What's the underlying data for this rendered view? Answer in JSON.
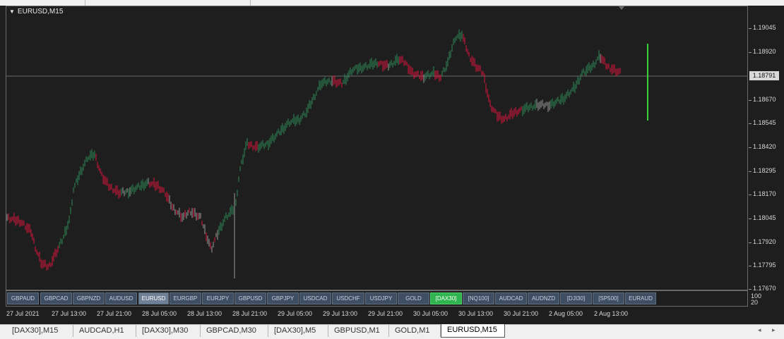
{
  "chart": {
    "symbol": "EURUSD,M15",
    "current_price": "1.18791",
    "price_ticks": [
      "1.19045",
      "1.18920",
      "1.18791",
      "1.18670",
      "1.18545",
      "1.18420",
      "1.18295",
      "1.18170",
      "1.18045",
      "1.17920",
      "1.17795",
      "1.17670"
    ],
    "indicator_ticks": [
      "100",
      "20"
    ],
    "time_labels": [
      "27 Jul 2021",
      "27 Jul 13:00",
      "27 Jul 21:00",
      "28 Jul 05:00",
      "28 Jul 13:00",
      "28 Jul 21:00",
      "29 Jul 05:00",
      "29 Jul 13:00",
      "29 Jul 21:00",
      "30 Jul 05:00",
      "30 Jul 13:00",
      "30 Jul 21:00",
      "2 Aug 05:00",
      "2 Aug 13:00"
    ],
    "colors": {
      "bull": "#2e8b57",
      "bear": "#dc143c",
      "neutral": "#9a9a9a",
      "background": "#1e1e1e",
      "grid_line": "#6a6a6a",
      "highlight_bar": "#3bd13b"
    }
  },
  "symbol_buttons": [
    {
      "label": "GBPAUD",
      "state": "normal"
    },
    {
      "label": "GBPCAD",
      "state": "normal"
    },
    {
      "label": "GBPNZD",
      "state": "normal"
    },
    {
      "label": "AUDUSD",
      "state": "normal"
    },
    {
      "label": "EURUSD",
      "state": "active"
    },
    {
      "label": "EURGBP",
      "state": "normal"
    },
    {
      "label": "EURJPY",
      "state": "normal"
    },
    {
      "label": "GBPUSD",
      "state": "normal"
    },
    {
      "label": "GBPJPY",
      "state": "normal"
    },
    {
      "label": "USDCAD",
      "state": "normal"
    },
    {
      "label": "USDCHF",
      "state": "normal"
    },
    {
      "label": "USDJPY",
      "state": "normal"
    },
    {
      "label": "GOLD",
      "state": "normal"
    },
    {
      "label": "[DAX30]",
      "state": "hot"
    },
    {
      "label": "[NQ100]",
      "state": "normal"
    },
    {
      "label": "AUDCAD",
      "state": "normal"
    },
    {
      "label": "AUDNZD",
      "state": "normal"
    },
    {
      "label": "[DJI30]",
      "state": "normal"
    },
    {
      "label": "[SP500]",
      "state": "normal"
    },
    {
      "label": "EURAUD",
      "state": "normal"
    }
  ],
  "tabs": [
    {
      "label": "[DAX30],M15",
      "active": false
    },
    {
      "label": "AUDCAD,H1",
      "active": false
    },
    {
      "label": "[DAX30],M30",
      "active": false
    },
    {
      "label": "GBPCAD,M30",
      "active": false
    },
    {
      "label": "[DAX30],M5",
      "active": false
    },
    {
      "label": "GBPUSD,M1",
      "active": false
    },
    {
      "label": "GOLD,M1",
      "active": false
    },
    {
      "label": "EURUSD,M15",
      "active": true
    }
  ],
  "scroll": {
    "left_icon": "chevron-left-icon",
    "right_icon": "chevron-right-icon",
    "left_glyph": "◂",
    "right_glyph": "▸"
  }
}
